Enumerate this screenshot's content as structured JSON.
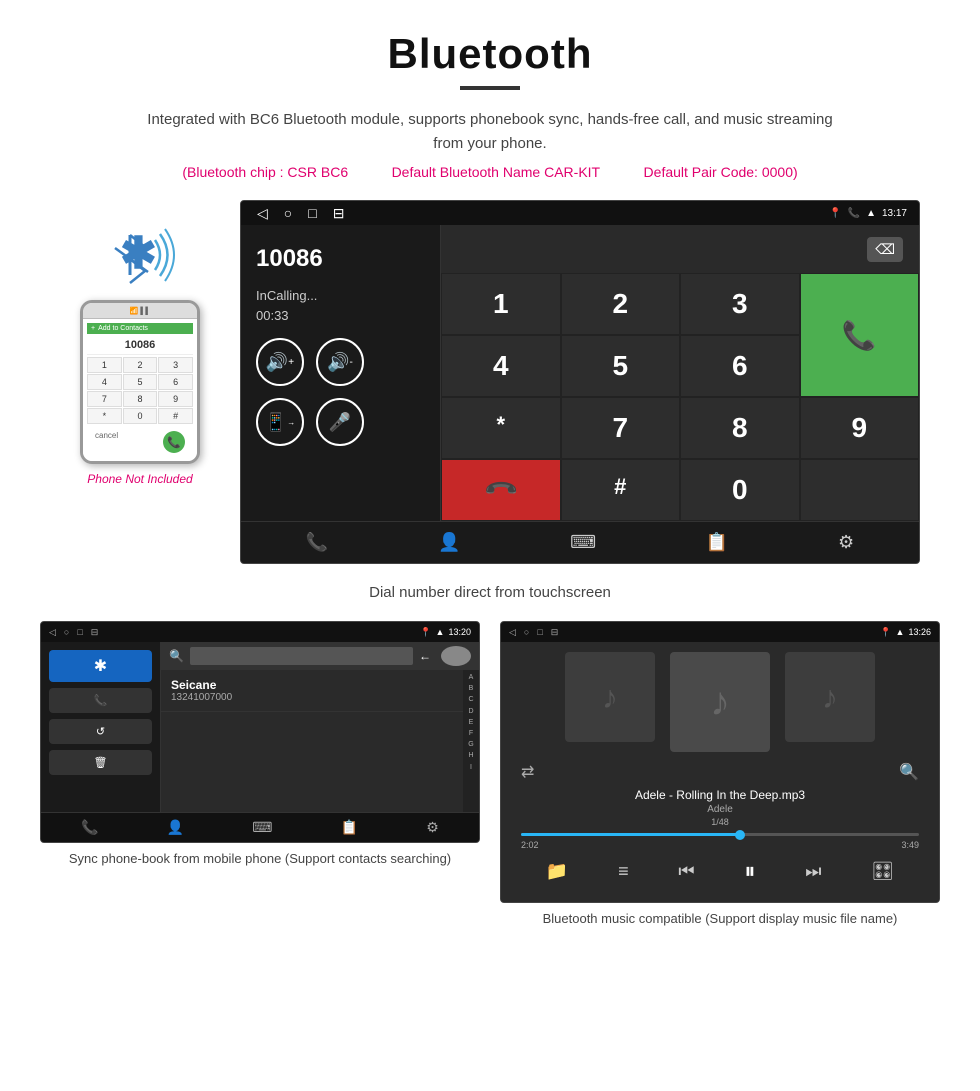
{
  "header": {
    "title": "Bluetooth",
    "description": "Integrated with BC6 Bluetooth module, supports phonebook sync, hands-free call, and music streaming from your phone.",
    "specs": {
      "chip": "(Bluetooth chip : CSR BC6",
      "name": "Default Bluetooth Name CAR-KIT",
      "pair_code": "Default Pair Code: 0000)"
    }
  },
  "main_screen": {
    "status_bar": {
      "time": "13:17",
      "nav_icons": [
        "◁",
        "○",
        "□",
        "⊟"
      ]
    },
    "dialer": {
      "number": "10086",
      "status": "InCalling...",
      "timer": "00:33",
      "controls": [
        "🔊+",
        "🔊-",
        "📱→",
        "🎤"
      ]
    },
    "numpad": {
      "keys": [
        "1",
        "2",
        "3",
        "*",
        "4",
        "5",
        "6",
        "0",
        "7",
        "8",
        "9",
        "#"
      ]
    },
    "caption": "Dial number direct from touchscreen"
  },
  "phone_left": {
    "not_included": "Phone Not Included"
  },
  "phonebook_screen": {
    "status_bar": {
      "time": "13:20"
    },
    "contact": {
      "name": "Seicane",
      "number": "13241007000"
    },
    "alphabet": [
      "A",
      "B",
      "C",
      "D",
      "E",
      "F",
      "G",
      "H",
      "I"
    ],
    "caption": "Sync phone-book from mobile phone\n(Support contacts searching)"
  },
  "music_screen": {
    "status_bar": {
      "time": "13:26"
    },
    "song_name": "Adele - Rolling In the Deep.mp3",
    "artist": "Adele",
    "track": "1/48",
    "time_current": "2:02",
    "time_total": "3:49",
    "caption": "Bluetooth music compatible\n(Support display music file name)"
  }
}
